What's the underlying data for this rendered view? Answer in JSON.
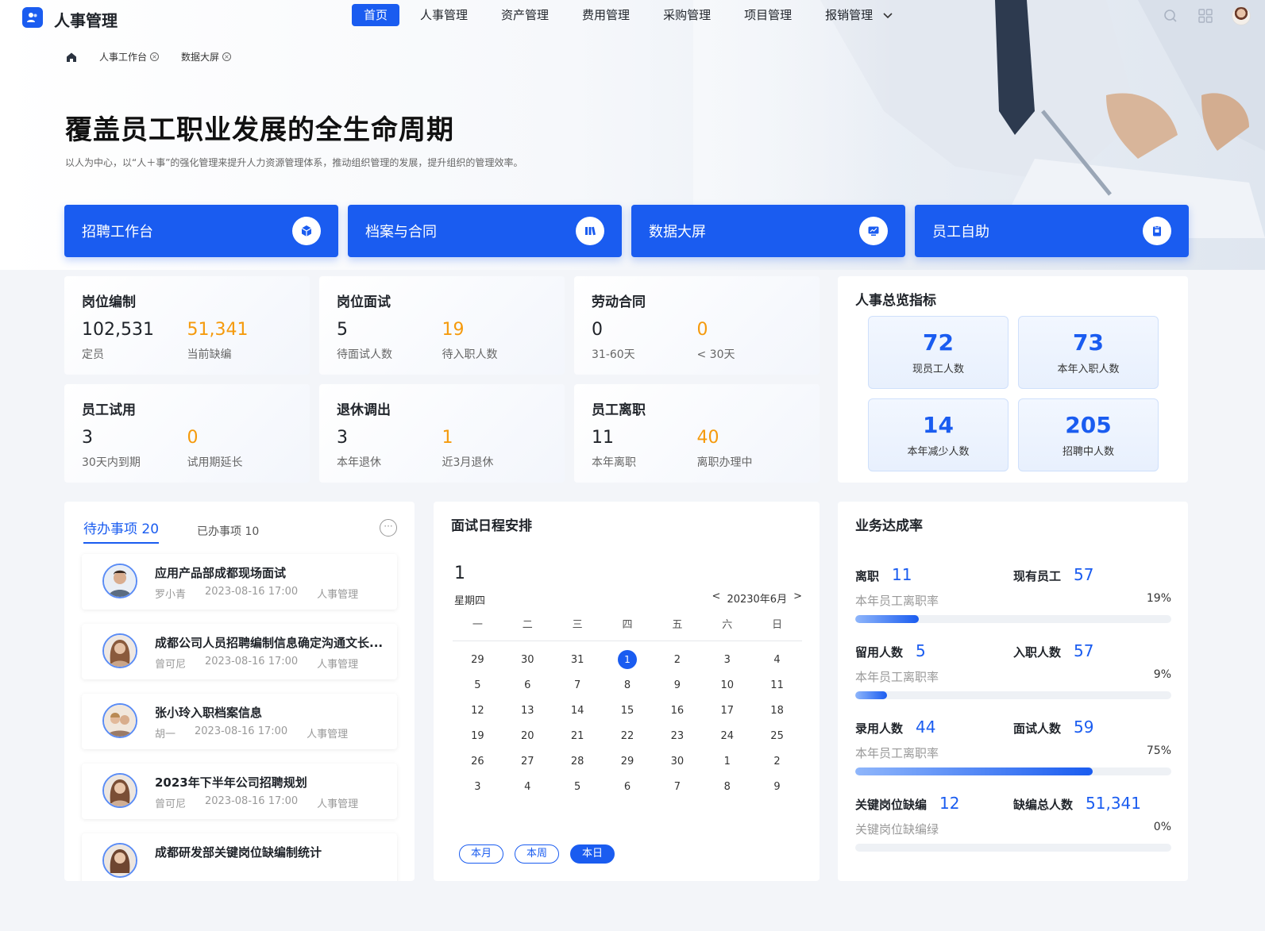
{
  "app": {
    "title": "人事管理"
  },
  "nav": {
    "items": [
      "首页",
      "人事管理",
      "资产管理",
      "费用管理",
      "采购管理",
      "项目管理",
      "报销管理"
    ],
    "active_index": 0
  },
  "breadcrumb": {
    "items": [
      "人事工作台",
      "数据大屏"
    ]
  },
  "hero": {
    "title": "覆盖员工职业发展的全生命周期",
    "subtitle": "以人为中心，以“人＋事”的强化管理来提升人力资源管理体系，推动组织管理的发展，提升组织的管理效率。"
  },
  "quick": [
    {
      "label": "招聘工作台",
      "icon": "cube-icon"
    },
    {
      "label": "档案与合同",
      "icon": "books-icon"
    },
    {
      "label": "数据大屏",
      "icon": "chart-screen-icon"
    },
    {
      "label": "员工自助",
      "icon": "clipboard-icon"
    }
  ],
  "stats": [
    {
      "title": "岗位编制",
      "a_val": "102,531",
      "a_label": "定员",
      "b_val": "51,341",
      "b_label": "当前缺编"
    },
    {
      "title": "岗位面试",
      "a_val": "5",
      "a_label": "待面试人数",
      "b_val": "19",
      "b_label": "待入职人数"
    },
    {
      "title": "劳动合同",
      "a_val": "0",
      "a_label": "31-60天",
      "b_val": "0",
      "b_label": "< 30天"
    },
    {
      "title": "员工试用",
      "a_val": "3",
      "a_label": "30天内到期",
      "b_val": "0",
      "b_label": "试用期延长"
    },
    {
      "title": "退休调出",
      "a_val": "3",
      "a_label": "本年退休",
      "b_val": "1",
      "b_label": "近3月退休"
    },
    {
      "title": "员工离职",
      "a_val": "11",
      "a_label": "本年离职",
      "b_val": "40",
      "b_label": "离职办理中"
    }
  ],
  "overview": {
    "title": "人事总览指标",
    "items": [
      {
        "value": "72",
        "label": "现员工人数"
      },
      {
        "value": "73",
        "label": "本年入职人数"
      },
      {
        "value": "14",
        "label": "本年减少人数"
      },
      {
        "value": "205",
        "label": "招聘中人数"
      }
    ]
  },
  "todo": {
    "tab_active": "待办事项 20",
    "tab_done": "已办事项 10",
    "more": "···",
    "items": [
      {
        "title": "应用产品部成都现场面试",
        "person": "罗小青",
        "time": "2023-08-16 17:00",
        "module": "人事管理"
      },
      {
        "title": "成都公司人员招聘编制信息确定沟通文长...",
        "person": "曾可尼",
        "time": "2023-08-16 17:00",
        "module": "人事管理"
      },
      {
        "title": "张小玲入职档案信息",
        "person": "胡一",
        "time": "2023-08-16 17:00",
        "module": "人事管理"
      },
      {
        "title": "2023年下半年公司招聘规划",
        "person": "曾可尼",
        "time": "2023-08-16 17:00",
        "module": "人事管理"
      },
      {
        "title": "成都研发部关键岗位缺编制统计",
        "person": "",
        "time": "",
        "module": ""
      }
    ]
  },
  "calendar": {
    "title": "面试日程安排",
    "day": "1",
    "weekday": "星期四",
    "month_prev": "<",
    "month": "20230年6月",
    "month_next": ">",
    "week_headers": [
      "一",
      "二",
      "三",
      "四",
      "五",
      "六",
      "日"
    ],
    "rows": [
      [
        "29",
        "30",
        "31",
        "1",
        "2",
        "3",
        "4"
      ],
      [
        "5",
        "6",
        "7",
        "8",
        "9",
        "10",
        "11"
      ],
      [
        "12",
        "13",
        "14",
        "15",
        "16",
        "17",
        "18"
      ],
      [
        "19",
        "20",
        "21",
        "22",
        "23",
        "24",
        "25"
      ],
      [
        "26",
        "27",
        "28",
        "29",
        "30",
        "1",
        "2"
      ],
      [
        "3",
        "4",
        "5",
        "6",
        "7",
        "8",
        "9"
      ]
    ],
    "buttons": [
      "本月",
      "本周",
      "本日"
    ],
    "active_button": 2
  },
  "rate": {
    "title": "业务达成率",
    "blocks": [
      {
        "k1": "离职",
        "v1": "11",
        "k2": "现有员工",
        "v2": "57",
        "sub": "本年员工离职率",
        "pct": "19%",
        "fill": 0.2
      },
      {
        "k1": "留用人数",
        "v1": "5",
        "k2": "入职人数",
        "v2": "57",
        "sub": "本年员工离职率",
        "pct": "9%",
        "fill": 0.1
      },
      {
        "k1": "录用人数",
        "v1": "44",
        "k2": "面试人数",
        "v2": "59",
        "sub": "本年员工离职率",
        "pct": "75%",
        "fill": 0.75
      },
      {
        "k1": "关键岗位缺编",
        "v1": "12",
        "k2": "缺编总人数",
        "v2": "51,341",
        "sub": "关键岗位缺编绿",
        "pct": "0%",
        "fill": 0
      }
    ]
  },
  "colors": {
    "primary": "#1a5cf0",
    "orange": "#f59a0c"
  }
}
